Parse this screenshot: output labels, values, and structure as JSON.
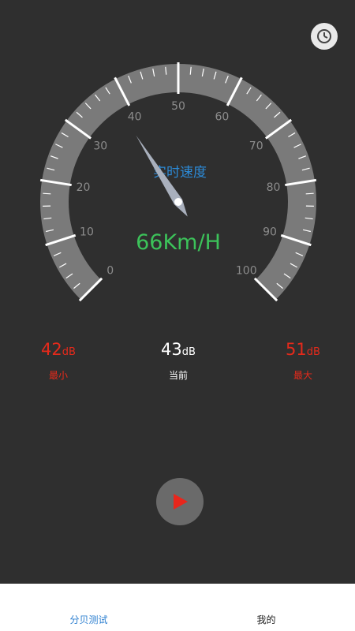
{
  "header": {
    "history_icon": "clock-icon"
  },
  "gauge": {
    "min": 0,
    "max": 100,
    "needle_value": 38,
    "tick_labels": [
      "0",
      "10",
      "20",
      "30",
      "40",
      "50",
      "60",
      "70",
      "80",
      "90",
      "100"
    ],
    "center_label": "实时速度",
    "reading": "66Km/H",
    "colors": {
      "track": "#7a7a7a",
      "ticks": "#ffffff",
      "label": "#2c8ad6",
      "reading": "#3cc35a",
      "needle": "#a9b0bd"
    }
  },
  "stats": {
    "min": {
      "value": "42",
      "unit": "dB",
      "label": "最小"
    },
    "current": {
      "value": "43",
      "unit": "dB",
      "label": "当前"
    },
    "max": {
      "value": "51",
      "unit": "dB",
      "label": "最大"
    }
  },
  "controls": {
    "play_icon": "play-icon"
  },
  "bottom_nav": {
    "items": [
      {
        "label": "分贝测试",
        "active": true
      },
      {
        "label": "我的",
        "active": false
      }
    ]
  }
}
